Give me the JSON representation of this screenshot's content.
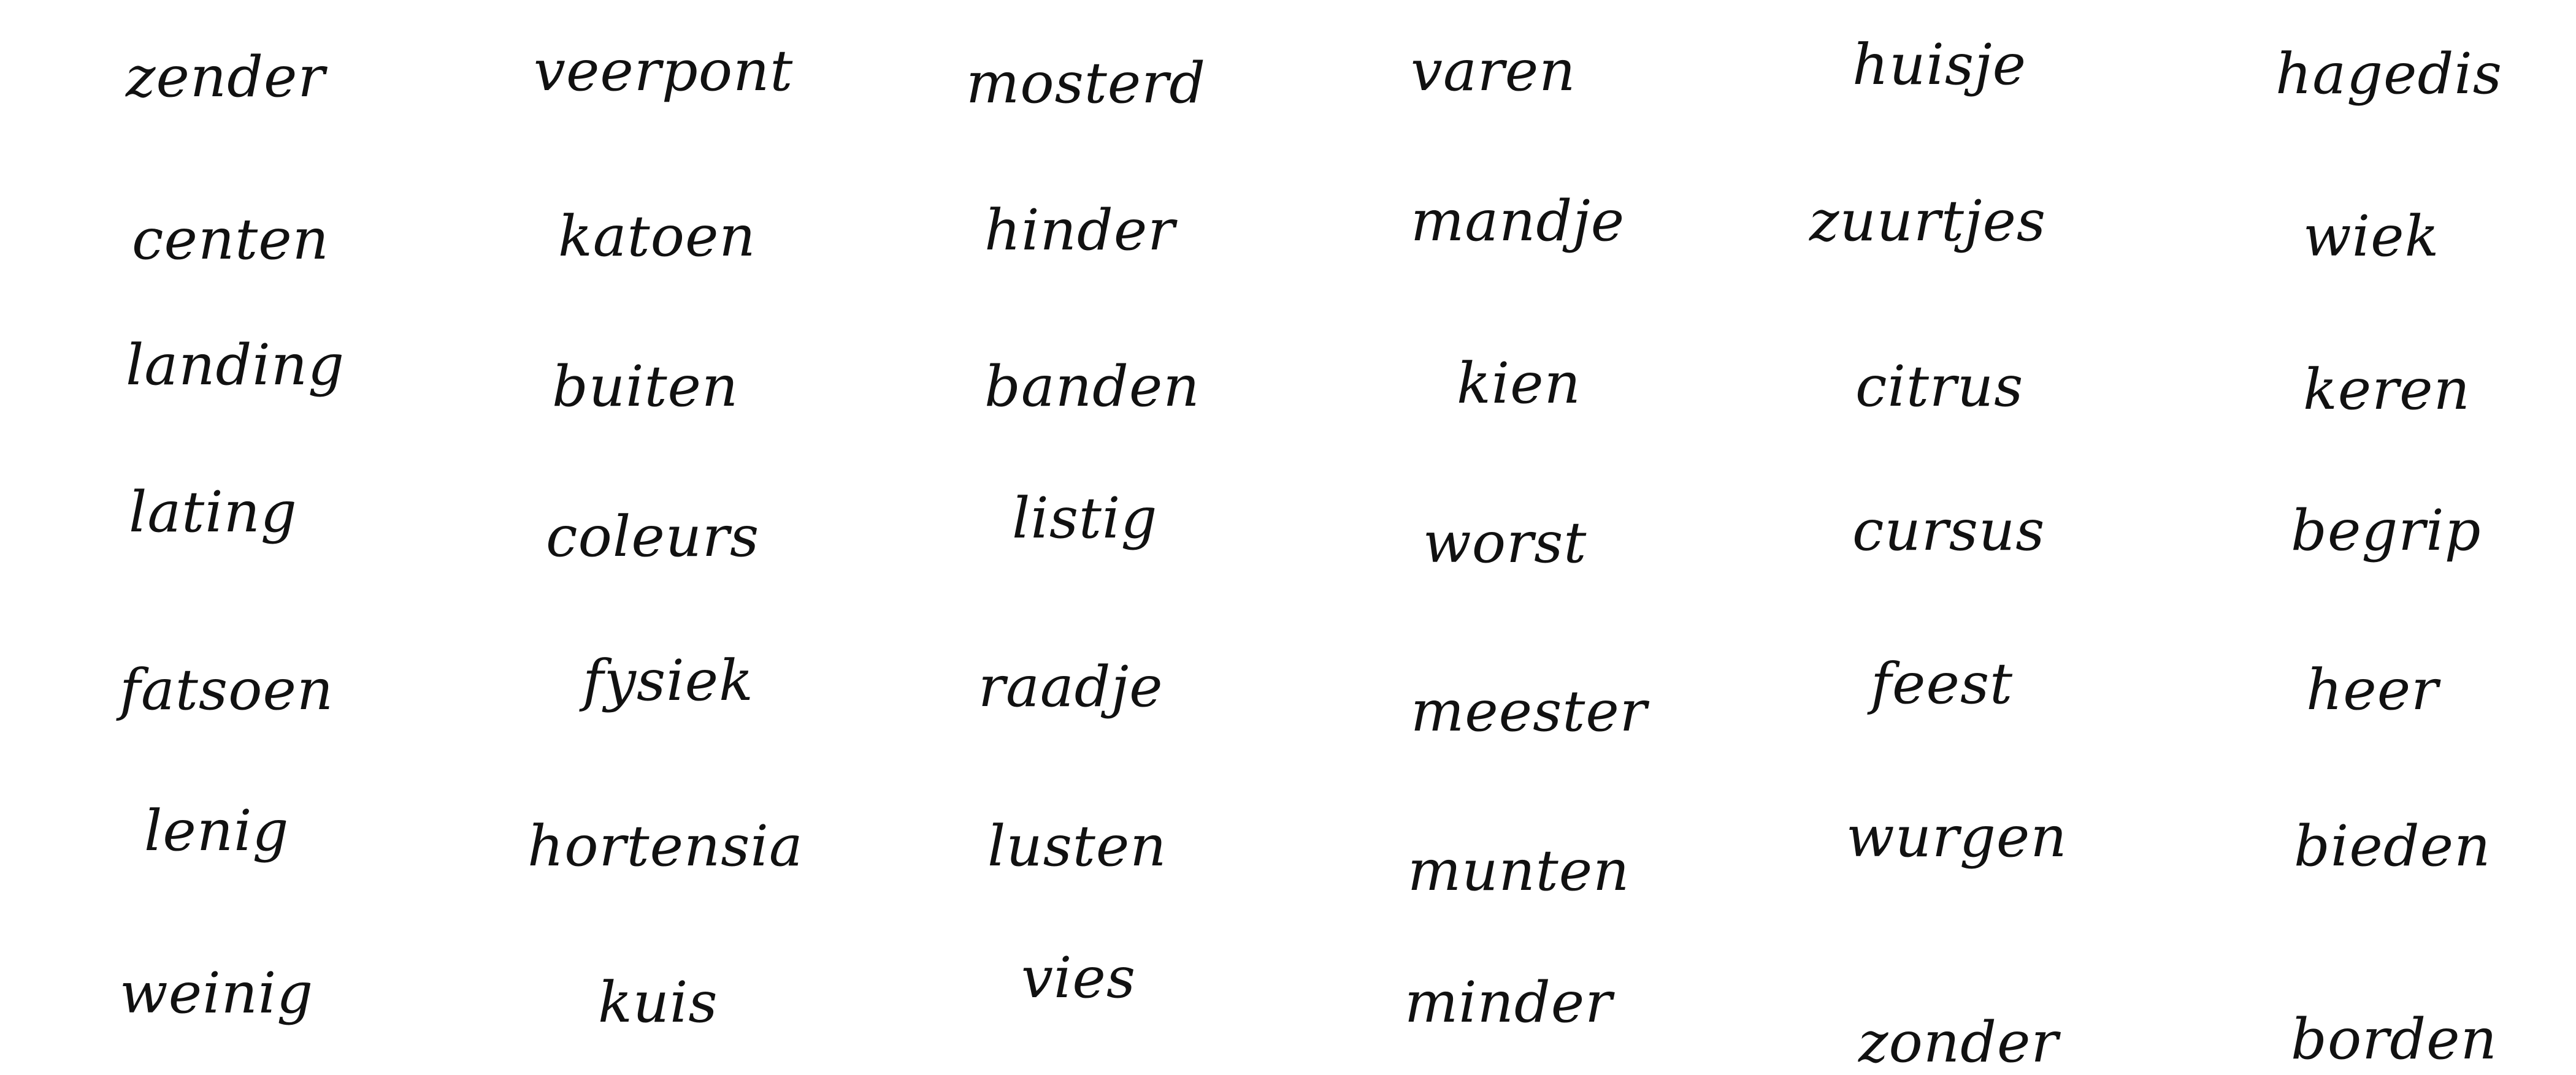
{
  "words": {
    "r1": [
      "zender",
      "veerpont",
      "mosterd",
      "varen",
      "huisje",
      "hagedis"
    ],
    "r2": [
      "centen",
      "katoen",
      "hinder",
      "mandje",
      "zuurtjes",
      "wiek"
    ],
    "r3": [
      "landing",
      "buiten",
      "banden",
      "kien",
      "citrus",
      "keren"
    ],
    "r4": [
      "lating",
      "coleurs",
      "listig",
      "worst",
      "cursus",
      "begrip"
    ],
    "r5": [
      "fatsoen",
      "fysiek",
      "raadje",
      "meester",
      "feest",
      "heer"
    ],
    "r6": [
      "lenig",
      "hortensia",
      "lusten",
      "munten",
      "wurgen",
      "bieden"
    ],
    "r7": [
      "weinig",
      "kuis",
      "vies",
      "minder",
      "zonder",
      "borden"
    ]
  },
  "ink_color": "#111111"
}
